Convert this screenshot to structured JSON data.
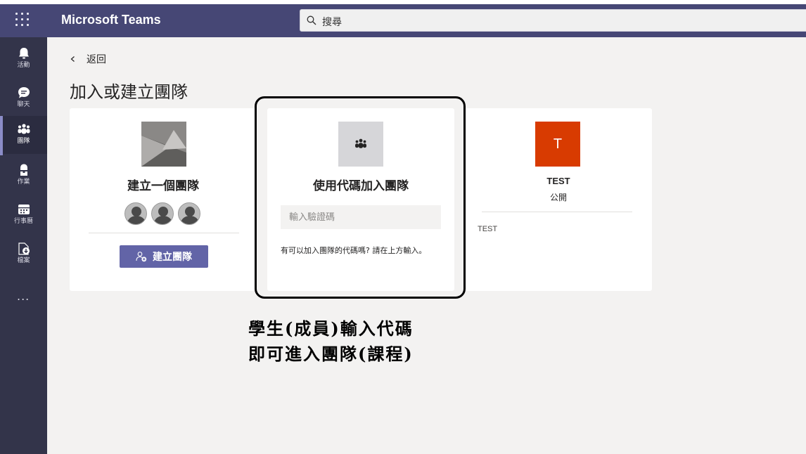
{
  "app": {
    "title": "Microsoft Teams"
  },
  "search": {
    "placeholder": "搜尋"
  },
  "rail": {
    "items": [
      {
        "label": "活動",
        "icon": "bell-icon"
      },
      {
        "label": "聊天",
        "icon": "chat-icon"
      },
      {
        "label": "團隊",
        "icon": "teams-icon",
        "active": true
      },
      {
        "label": "作業",
        "icon": "assignments-icon"
      },
      {
        "label": "行事曆",
        "icon": "calendar-icon"
      },
      {
        "label": "檔案",
        "icon": "files-icon"
      }
    ],
    "more": "..."
  },
  "main": {
    "back_label": "返回",
    "title": "加入或建立團隊",
    "cards": {
      "create": {
        "title": "建立一個團隊",
        "button_label": "建立團隊"
      },
      "join": {
        "title": "使用代碼加入團隊",
        "input_placeholder": "輸入驗證碼",
        "hint": "有可以加入團隊的代碼嗎? 請在上方輸入。"
      },
      "team": {
        "initial": "T",
        "name": "TEST",
        "visibility": "公開",
        "tag": "TEST"
      }
    }
  },
  "annotation": {
    "line1": "學生(成員)輸入代碼",
    "line2": "即可進入團隊(課程)"
  },
  "colors": {
    "topbar": "#464775",
    "rail": "#33344a",
    "accent": "#6264a7",
    "team_tile": "#d83b01"
  }
}
